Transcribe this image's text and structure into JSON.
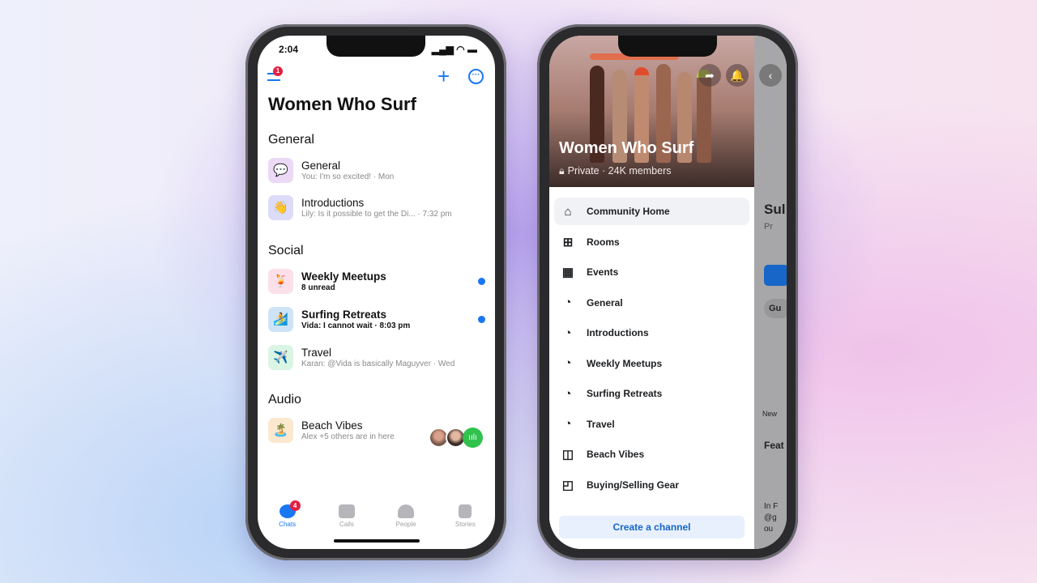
{
  "left_phone": {
    "status_time": "2:04",
    "menu_badge": "1",
    "title": "Women Who Surf",
    "sections": [
      {
        "label": "General",
        "items": [
          {
            "name": "General",
            "sub": "You: I'm so excited!  · Mon",
            "icon": "💬",
            "bg": "#ecd9f5",
            "unread": false
          },
          {
            "name": "Introductions",
            "sub": "Lily: Is it possible to get the Di...  · 7:32 pm",
            "icon": "👋",
            "bg": "#dcdcf9",
            "unread": false
          }
        ]
      },
      {
        "label": "Social",
        "items": [
          {
            "name": "Weekly Meetups",
            "sub": "8 unread",
            "icon": "🍹",
            "bg": "#fbe0ea",
            "unread": true
          },
          {
            "name": "Surfing Retreats",
            "sub": "Vida: I cannot wait · 8:03 pm",
            "icon": "🏄",
            "bg": "#cfe3f7",
            "unread": true
          },
          {
            "name": "Travel",
            "sub": "Karan: @Vida is basically Maguyver · Wed",
            "icon": "✈️",
            "bg": "#daf5e4",
            "unread": false
          }
        ]
      },
      {
        "label": "Audio",
        "items": [
          {
            "name": "Beach Vibes",
            "sub": "Alex +5 others are in here",
            "icon": "🏝️",
            "bg": "#fbe8cf",
            "unread": false
          }
        ]
      }
    ],
    "tabs": [
      {
        "label": "Chats",
        "badge": "4",
        "active": true
      },
      {
        "label": "Calls"
      },
      {
        "label": "People"
      },
      {
        "label": "Stories"
      }
    ],
    "accent": "#1877f2"
  },
  "right_phone": {
    "group_name": "Women Who Surf",
    "group_meta": "Private · 24K members",
    "menu": [
      {
        "label": "Community Home",
        "icon": "home-icon",
        "glyph": "⌂"
      },
      {
        "label": "Rooms",
        "icon": "video-plus-icon",
        "glyph": "⊞"
      },
      {
        "label": "Events",
        "icon": "calendar-icon",
        "glyph": "▦"
      },
      {
        "label": "General",
        "icon": "chat-channel-icon",
        "glyph": "◔"
      },
      {
        "label": "Introductions",
        "icon": "chat-channel-icon",
        "glyph": "◔"
      },
      {
        "label": "Weekly Meetups",
        "icon": "chat-channel-icon",
        "glyph": "◔"
      },
      {
        "label": "Surfing Retreats",
        "icon": "chat-lock-icon",
        "glyph": "◔"
      },
      {
        "label": "Travel",
        "icon": "chat-lock-icon",
        "glyph": "◔"
      },
      {
        "label": "Beach Vibes",
        "icon": "audio-lock-icon",
        "glyph": "◫"
      },
      {
        "label": "Buying/Selling Gear",
        "icon": "marketplace-channel-icon",
        "glyph": "◰"
      }
    ],
    "create_label": "Create a channel",
    "peek": {
      "title": "Sul",
      "meta": "Pr",
      "chip": "Gu",
      "new": "New",
      "feat": "Feat",
      "post": "In F @g ou"
    }
  }
}
